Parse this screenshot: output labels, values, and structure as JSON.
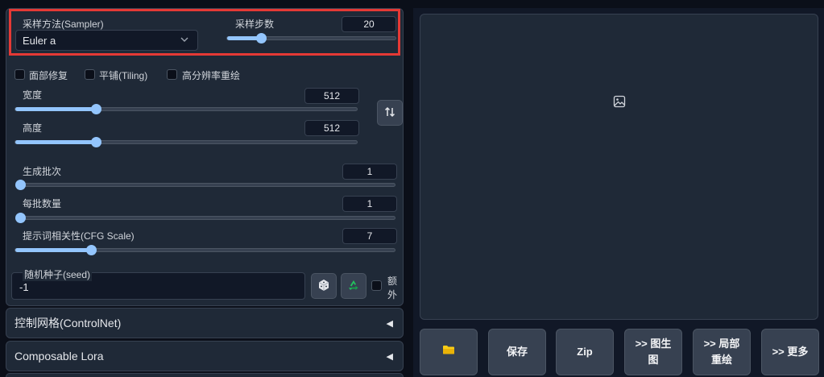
{
  "sampler": {
    "label": "采样方法(Sampler)",
    "value": "Euler a"
  },
  "steps": {
    "label": "采样步数",
    "value": "20",
    "fraction": 0.2
  },
  "checkboxes": [
    {
      "label": "面部修复",
      "checked": false
    },
    {
      "label": "平铺(Tiling)",
      "checked": false
    },
    {
      "label": "高分辨率重绘",
      "checked": false
    }
  ],
  "width": {
    "label": "宽度",
    "value": "512",
    "fraction": 0.235
  },
  "height": {
    "label": "高度",
    "value": "512",
    "fraction": 0.235
  },
  "batch_count": {
    "label": "生成批次",
    "value": "1",
    "fraction": 0.0
  },
  "batch_size": {
    "label": "每批数量",
    "value": "1",
    "fraction": 0.0
  },
  "cfg": {
    "label": "提示词相关性(CFG Scale)",
    "value": "7",
    "fraction": 0.2
  },
  "seed": {
    "label": "随机种子(seed)",
    "value": "-1",
    "extra_label_1": "额",
    "extra_label_2": "外"
  },
  "accordions": [
    {
      "label": "控制网格(ControlNet)"
    },
    {
      "label": "Composable Lora"
    }
  ],
  "actions": {
    "save": "保存",
    "zip": "Zip",
    "img2img_1": ">> 图生",
    "img2img_2": "图",
    "inpaint_1": ">> 局部",
    "inpaint_2": "重绘",
    "more": ">> 更多"
  },
  "icons": {
    "swap": "swap-dimensions-icon",
    "dice": "dice-icon",
    "recycle": "recycle-icon",
    "folder": "folder-icon",
    "image": "image-placeholder-icon"
  }
}
